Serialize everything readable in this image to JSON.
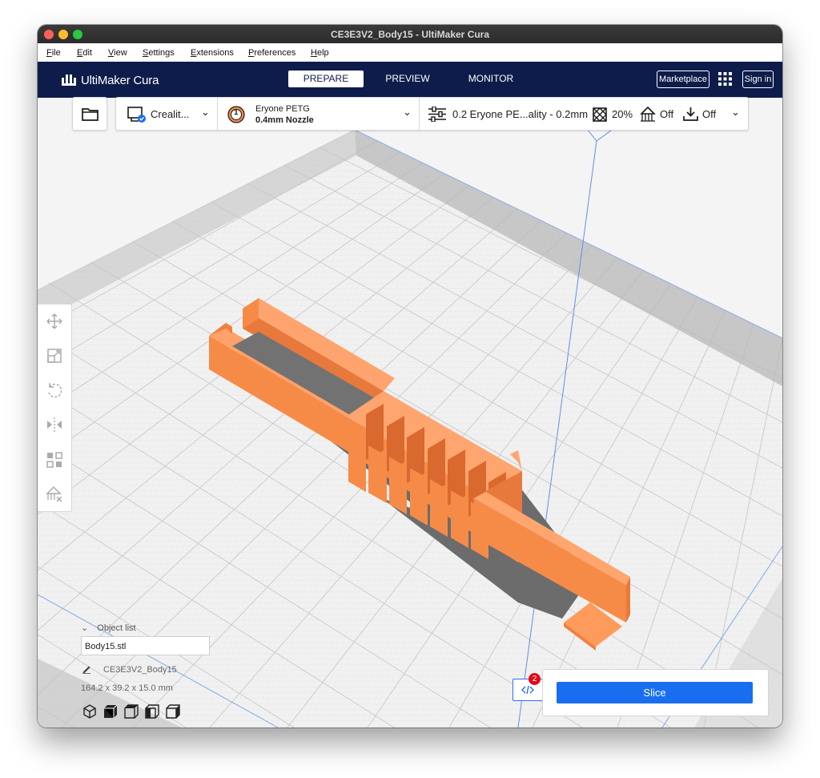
{
  "window": {
    "title": "CE3E3V2_Body15 - UltiMaker Cura"
  },
  "menu": [
    "File",
    "Edit",
    "View",
    "Settings",
    "Extensions",
    "Preferences",
    "Help"
  ],
  "header": {
    "logo": "UltiMaker Cura",
    "stages": [
      {
        "label": "PREPARE",
        "active": true
      },
      {
        "label": "PREVIEW",
        "active": false
      },
      {
        "label": "MONITOR",
        "active": false
      }
    ],
    "marketplace": "Marketplace",
    "signin": "Sign in"
  },
  "printer": {
    "name": "Crealit..."
  },
  "extruder": {
    "number": "1",
    "material": "Eryone PETG",
    "nozzle": "0.4mm Nozzle"
  },
  "print_settings": {
    "profile": "0.2 Eryone PE...ality - 0.2mm",
    "infill": "20%",
    "support": "Off",
    "adhesion": "Off"
  },
  "object_list": {
    "header": "Object list",
    "item": "Body15.stl",
    "project_name": "CE3E3V2_Body15",
    "dimensions": "164.2 x 39.2 x 15.0 mm"
  },
  "messages": {
    "count": "2"
  },
  "slice": {
    "label": "Slice"
  },
  "colors": {
    "header_bg": "#0d1c4a",
    "model": "#f68b48",
    "slice_button": "#196ef0",
    "badge": "#e20a19"
  }
}
